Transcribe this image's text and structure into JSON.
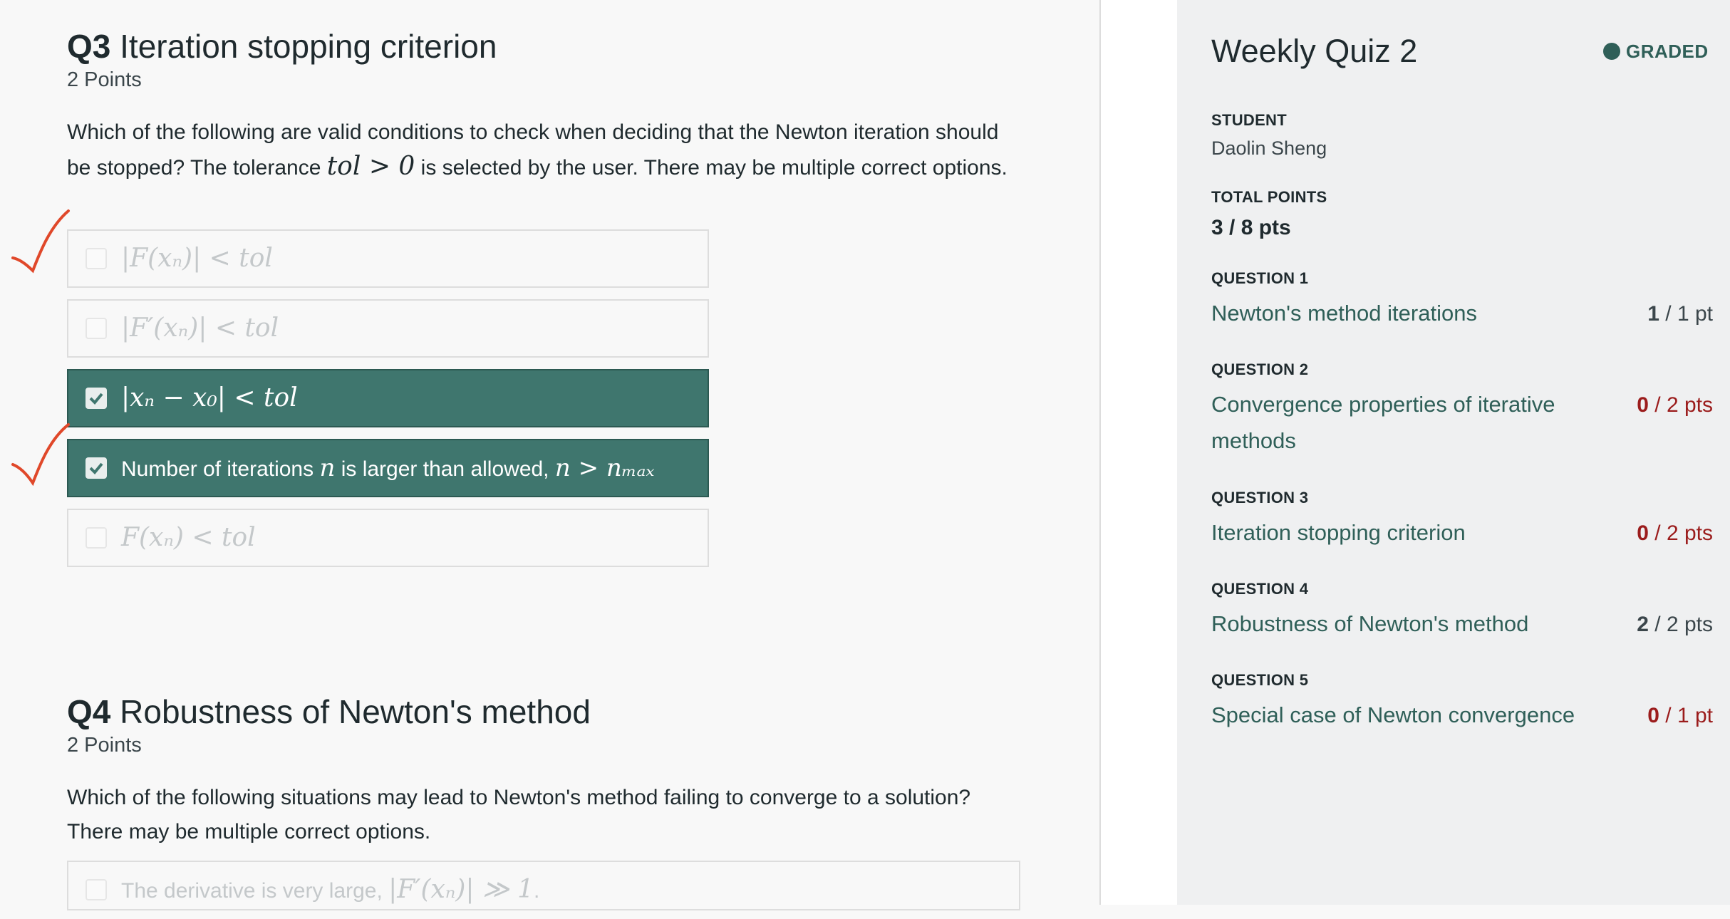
{
  "q3": {
    "number": "Q3",
    "title": "Iteration stopping criterion",
    "points": "2 Points",
    "text_1": "Which of the following are valid conditions to check when deciding that the Newton iteration should be stopped? The tolerance ",
    "text_math": "tol > 0",
    "text_2": " is selected by the user. There may be multiple correct options.",
    "options": [
      {
        "label": "|F(xₙ)| < tol",
        "selected": false
      },
      {
        "label": "|F′(xₙ)| < tol",
        "selected": false
      },
      {
        "label": "|xₙ − x₀| < tol",
        "selected": true
      },
      {
        "label_1": "Number of iterations ",
        "label_math_1": "n",
        "label_2": " is larger than allowed, ",
        "label_math_2": "n > nₘₐₓ",
        "selected": true
      },
      {
        "label": "F(xₙ) < tol",
        "selected": false
      }
    ]
  },
  "q4": {
    "number": "Q4",
    "title": "Robustness of Newton's method",
    "points": "2 Points",
    "text": "Which of the following situations may lead to Newton's method failing to converge to a solution? There may be multiple correct options.",
    "options": [
      {
        "label_1": "The derivative is very large, ",
        "label_math": "|F′(xₙ)| ≫ 1",
        "label_2": ".",
        "selected": false
      }
    ]
  },
  "sidebar": {
    "quiz_title": "Weekly Quiz 2",
    "status": "GRADED",
    "student_label": "STUDENT",
    "student_name": "Daolin Sheng",
    "total_label": "TOTAL POINTS",
    "total_value": "3 / 8 pts",
    "questions": [
      {
        "label": "QUESTION 1",
        "title": "Newton's method iterations",
        "score": "1",
        "score_rest": " / 1 pt"
      },
      {
        "label": "QUESTION 2",
        "title": "Convergence properties of iterative methods",
        "score": "0",
        "score_rest": " / 2 pts"
      },
      {
        "label": "QUESTION 3",
        "title": "Iteration stopping criterion",
        "score": "0",
        "score_rest": " / 2 pts"
      },
      {
        "label": "QUESTION 4",
        "title": "Robustness of Newton's method",
        "score": "2",
        "score_rest": " / 2 pts"
      },
      {
        "label": "QUESTION 5",
        "title": "Special case of Newton convergence",
        "score": "0",
        "score_rest": " / 1 pt"
      }
    ]
  },
  "colors": {
    "accent": "#3f766e",
    "error": "#9b1c1c",
    "annotation": "#e0482a"
  }
}
